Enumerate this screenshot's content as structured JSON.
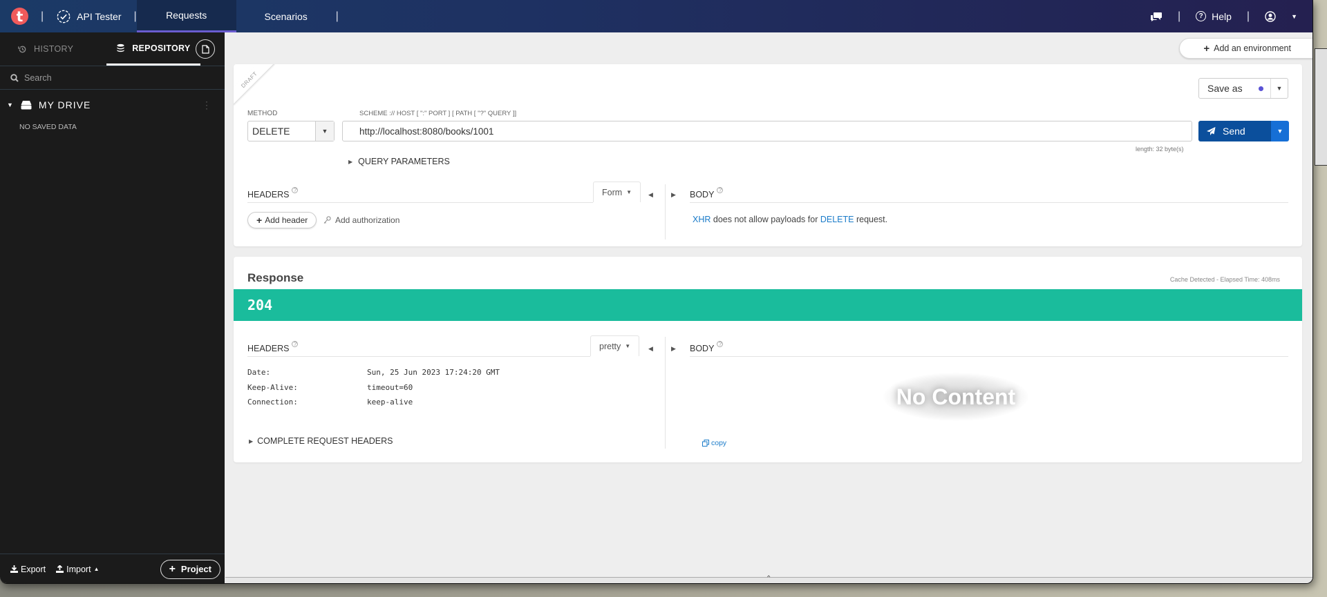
{
  "topbar": {
    "logo_letter": "t",
    "app_name": "API Tester",
    "tabs": [
      {
        "label": "Requests",
        "active": true
      },
      {
        "label": "Scenarios",
        "active": false
      }
    ],
    "help_label": "Help",
    "icons": {
      "feedback": "chat-bubbles-icon",
      "help": "question-circle-icon",
      "account": "user-circle-icon",
      "menu": "chevron-down-icon"
    }
  },
  "sidebar": {
    "tabs": [
      {
        "label": "HISTORY",
        "icon": "history-icon",
        "active": false
      },
      {
        "label": "REPOSITORY",
        "icon": "database-icon",
        "active": true
      }
    ],
    "search_placeholder": "Search",
    "drive_label": "MY DRIVE",
    "empty_text": "NO SAVED DATA",
    "export_label": "Export",
    "import_label": "Import",
    "project_label": "Project"
  },
  "environment": {
    "add_label": "Add an environment"
  },
  "request": {
    "badge": "DRAFT",
    "method_label": "METHOD",
    "method_value": "DELETE",
    "url_label": "SCHEME :// HOST [ \":\" PORT ] [ PATH [ \"?\" QUERY ]]",
    "url_value": "http://localhost:8080/books/1001",
    "length_text": "length: 32 byte(s)",
    "query_params_label": "QUERY PARAMETERS",
    "save_as_label": "Save as",
    "send_label": "Send",
    "headers_label": "HEADERS",
    "headers_mode": "Form",
    "add_header_label": "Add header",
    "add_authorization_label": "Add authorization",
    "body_label": "BODY",
    "body_message": {
      "part1": "XHR",
      "part2": " does not allow payloads for ",
      "part3": "DELETE",
      "part4": " request."
    }
  },
  "response": {
    "title": "Response",
    "elapsed_text": "Cache Detected - Elapsed Time: 408ms",
    "status_code": "204",
    "status_color": "#1abc9c",
    "headers_label": "HEADERS",
    "headers_mode": "pretty",
    "headers": [
      {
        "name": "Date:",
        "value": "Sun, 25 Jun 2023 17:24:20 GMT"
      },
      {
        "name": "Keep-Alive:",
        "value": "timeout=60"
      },
      {
        "name": "Connection:",
        "value": "keep-alive"
      }
    ],
    "complete_headers_label": "COMPLETE REQUEST HEADERS",
    "body_label": "BODY",
    "no_content_text": "No Content",
    "copy_label": "copy"
  }
}
